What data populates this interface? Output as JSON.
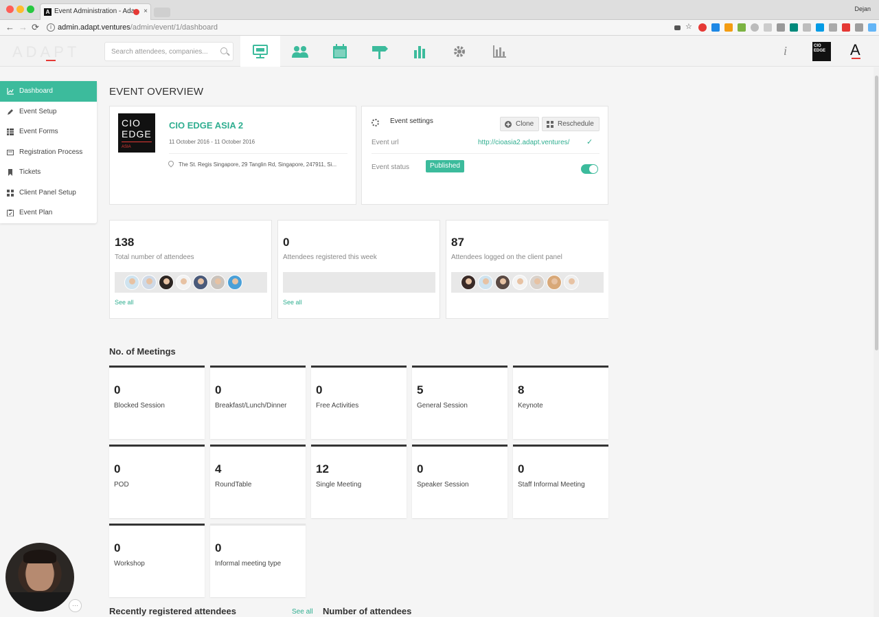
{
  "browser": {
    "tab_title": "Event Administration - Ada",
    "tab_close": "×",
    "favicon_text": "A",
    "user_name": "Dejan",
    "url_host": "admin.adapt.ventures",
    "url_path": "/admin/event/1/dashboard",
    "nav_back": "←",
    "nav_forward": "→",
    "nav_reload": "⟳",
    "info_glyph": "i"
  },
  "header": {
    "logo": "ADAPT",
    "search_placeholder": "Search attendees, companies...",
    "info_glyph": "i",
    "event_thumb": "CIO EDGE",
    "account_letter": "A",
    "nav_icons": [
      "presentation-icon",
      "people-icon",
      "calendar-icon",
      "signpost-icon",
      "bar-chart-icon",
      "gear-icon",
      "analytics-icon"
    ],
    "accent_color": "#3cbb9c"
  },
  "sidebar": {
    "items": [
      {
        "label": "Dashboard",
        "icon": "chart-icon",
        "active": true
      },
      {
        "label": "Event Setup",
        "icon": "pencil-icon"
      },
      {
        "label": "Event Forms",
        "icon": "grid-icon"
      },
      {
        "label": "Registration Process",
        "icon": "card-icon"
      },
      {
        "label": "Tickets",
        "icon": "bookmark-icon"
      },
      {
        "label": "Client Panel Setup",
        "icon": "grid-icon"
      },
      {
        "label": "Event Plan",
        "icon": "clipboard-icon"
      }
    ]
  },
  "main": {
    "title": "EVENT OVERVIEW",
    "event": {
      "logo_line1": "CIO",
      "logo_line2": "EDGE",
      "logo_line3": "ASIA",
      "name": "CIO EDGE ASIA 2",
      "dates": "11 October 2016 - 11 October 2016",
      "venue": "The St. Regis Singapore, 29 Tanglin Rd, Singapore, 247911, Si..."
    },
    "settings": {
      "title": "Event settings",
      "clone_label": "Clone",
      "reschedule_label": "Reschedule",
      "url_label": "Event url",
      "url_value": "http://cioasia2.adapt.ventures/",
      "check": "✓",
      "status_label": "Event status",
      "status_value": "Published",
      "status_toggle_on": true
    },
    "stats": [
      {
        "value": "138",
        "label": "Total number of attendees",
        "link": "See all",
        "avatars": 7
      },
      {
        "value": "0",
        "label": "Attendees registered this week",
        "link": "See all",
        "avatars": 0
      },
      {
        "value": "87",
        "label": "Attendees logged on the client panel",
        "link": "",
        "avatars": 7
      }
    ],
    "meetings_title": "No. of Meetings",
    "meetings": [
      {
        "value": "0",
        "label": "Blocked Session"
      },
      {
        "value": "0",
        "label": "Breakfast/Lunch/Dinner"
      },
      {
        "value": "0",
        "label": "Free Activities"
      },
      {
        "value": "5",
        "label": "General Session"
      },
      {
        "value": "8",
        "label": "Keynote"
      },
      {
        "value": "0",
        "label": "POD"
      },
      {
        "value": "4",
        "label": "RoundTable"
      },
      {
        "value": "12",
        "label": "Single Meeting"
      },
      {
        "value": "0",
        "label": "Speaker Session"
      },
      {
        "value": "0",
        "label": "Staff Informal Meeting"
      },
      {
        "value": "0",
        "label": "Workshop"
      },
      {
        "value": "0",
        "label": "Informal meeting type"
      }
    ],
    "recent_title": "Recently registered attendees",
    "recent_link": "See all",
    "count_title": "Number of attendees"
  },
  "webcam": {
    "more_glyph": "···"
  }
}
